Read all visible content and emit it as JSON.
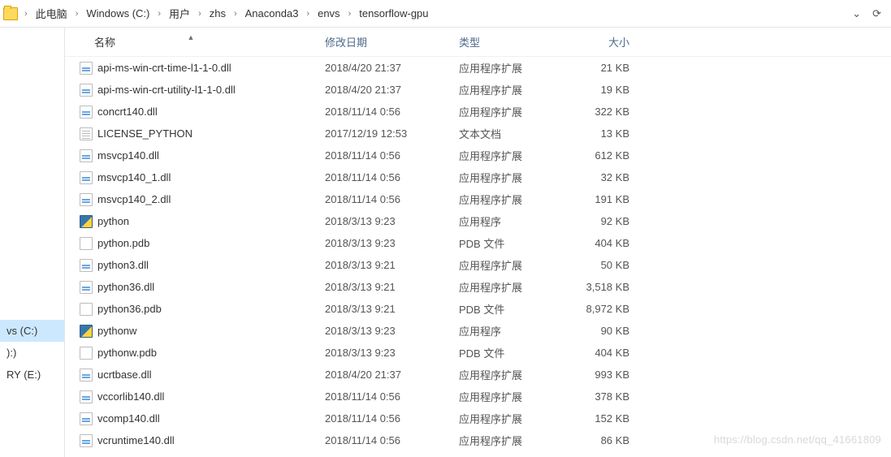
{
  "breadcrumb": {
    "items": [
      "此电脑",
      "Windows (C:)",
      "用户",
      "zhs",
      "Anaconda3",
      "envs",
      "tensorflow-gpu"
    ]
  },
  "navrail": {
    "items": [
      {
        "label": "vs (C:)",
        "selected": true
      },
      {
        "label": "):)",
        "selected": false
      },
      {
        "label": "RY (E:)",
        "selected": false
      }
    ]
  },
  "columns": {
    "name": "名称",
    "date": "修改日期",
    "type": "类型",
    "size": "大小"
  },
  "files": [
    {
      "icon": "dll",
      "name": "api-ms-win-crt-time-l1-1-0.dll",
      "date": "2018/4/20 21:37",
      "type": "应用程序扩展",
      "size": "21 KB"
    },
    {
      "icon": "dll",
      "name": "api-ms-win-crt-utility-l1-1-0.dll",
      "date": "2018/4/20 21:37",
      "type": "应用程序扩展",
      "size": "19 KB"
    },
    {
      "icon": "dll",
      "name": "concrt140.dll",
      "date": "2018/11/14 0:56",
      "type": "应用程序扩展",
      "size": "322 KB"
    },
    {
      "icon": "txt",
      "name": "LICENSE_PYTHON",
      "date": "2017/12/19 12:53",
      "type": "文本文档",
      "size": "13 KB"
    },
    {
      "icon": "dll",
      "name": "msvcp140.dll",
      "date": "2018/11/14 0:56",
      "type": "应用程序扩展",
      "size": "612 KB"
    },
    {
      "icon": "dll",
      "name": "msvcp140_1.dll",
      "date": "2018/11/14 0:56",
      "type": "应用程序扩展",
      "size": "32 KB"
    },
    {
      "icon": "dll",
      "name": "msvcp140_2.dll",
      "date": "2018/11/14 0:56",
      "type": "应用程序扩展",
      "size": "191 KB"
    },
    {
      "icon": "exe",
      "name": "python",
      "date": "2018/3/13 9:23",
      "type": "应用程序",
      "size": "92 KB"
    },
    {
      "icon": "pdb",
      "name": "python.pdb",
      "date": "2018/3/13 9:23",
      "type": "PDB 文件",
      "size": "404 KB"
    },
    {
      "icon": "dll",
      "name": "python3.dll",
      "date": "2018/3/13 9:21",
      "type": "应用程序扩展",
      "size": "50 KB"
    },
    {
      "icon": "dll",
      "name": "python36.dll",
      "date": "2018/3/13 9:21",
      "type": "应用程序扩展",
      "size": "3,518 KB"
    },
    {
      "icon": "pdb",
      "name": "python36.pdb",
      "date": "2018/3/13 9:21",
      "type": "PDB 文件",
      "size": "8,972 KB"
    },
    {
      "icon": "exe",
      "name": "pythonw",
      "date": "2018/3/13 9:23",
      "type": "应用程序",
      "size": "90 KB"
    },
    {
      "icon": "pdb",
      "name": "pythonw.pdb",
      "date": "2018/3/13 9:23",
      "type": "PDB 文件",
      "size": "404 KB"
    },
    {
      "icon": "dll",
      "name": "ucrtbase.dll",
      "date": "2018/4/20 21:37",
      "type": "应用程序扩展",
      "size": "993 KB"
    },
    {
      "icon": "dll",
      "name": "vccorlib140.dll",
      "date": "2018/11/14 0:56",
      "type": "应用程序扩展",
      "size": "378 KB"
    },
    {
      "icon": "dll",
      "name": "vcomp140.dll",
      "date": "2018/11/14 0:56",
      "type": "应用程序扩展",
      "size": "152 KB"
    },
    {
      "icon": "dll",
      "name": "vcruntime140.dll",
      "date": "2018/11/14 0:56",
      "type": "应用程序扩展",
      "size": "86 KB"
    }
  ],
  "watermark": "https://blog.csdn.net/qq_41661809"
}
